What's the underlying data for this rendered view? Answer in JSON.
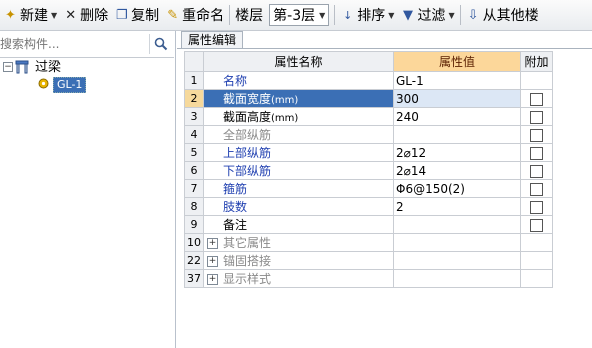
{
  "toolbar": {
    "new_label": "新建",
    "delete_label": "删除",
    "copy_label": "复制",
    "rename_label": "重命名",
    "floor_label": "楼层",
    "floor_value": "第-3层",
    "sort_label": "排序",
    "filter_label": "过滤",
    "copy_from_label": "从其他楼"
  },
  "search": {
    "placeholder": "搜索构件..."
  },
  "tree": {
    "root_label": "过梁",
    "child_label": "GL-1"
  },
  "panel": {
    "tab_label": "属性编辑"
  },
  "grid": {
    "headers": {
      "name": "属性名称",
      "value": "属性值",
      "add": "附加"
    },
    "rows": [
      {
        "num": "1",
        "name": "名称",
        "value": "GL-1"
      },
      {
        "num": "2",
        "name": "截面宽度",
        "unit": "(mm)",
        "value": "300"
      },
      {
        "num": "3",
        "name": "截面高度",
        "unit": "(mm)",
        "value": "240"
      },
      {
        "num": "4",
        "name": "全部纵筋",
        "value": ""
      },
      {
        "num": "5",
        "name": "上部纵筋",
        "value": "2⌀12"
      },
      {
        "num": "6",
        "name": "下部纵筋",
        "value": "2⌀14"
      },
      {
        "num": "7",
        "name": "箍筋",
        "value": "Φ6@150(2)"
      },
      {
        "num": "8",
        "name": "肢数",
        "value": "2"
      },
      {
        "num": "9",
        "name": "备注",
        "value": ""
      }
    ],
    "groups": [
      {
        "num": "10",
        "name": "其它属性"
      },
      {
        "num": "22",
        "name": "锚固搭接"
      },
      {
        "num": "37",
        "name": "显示样式"
      }
    ]
  }
}
